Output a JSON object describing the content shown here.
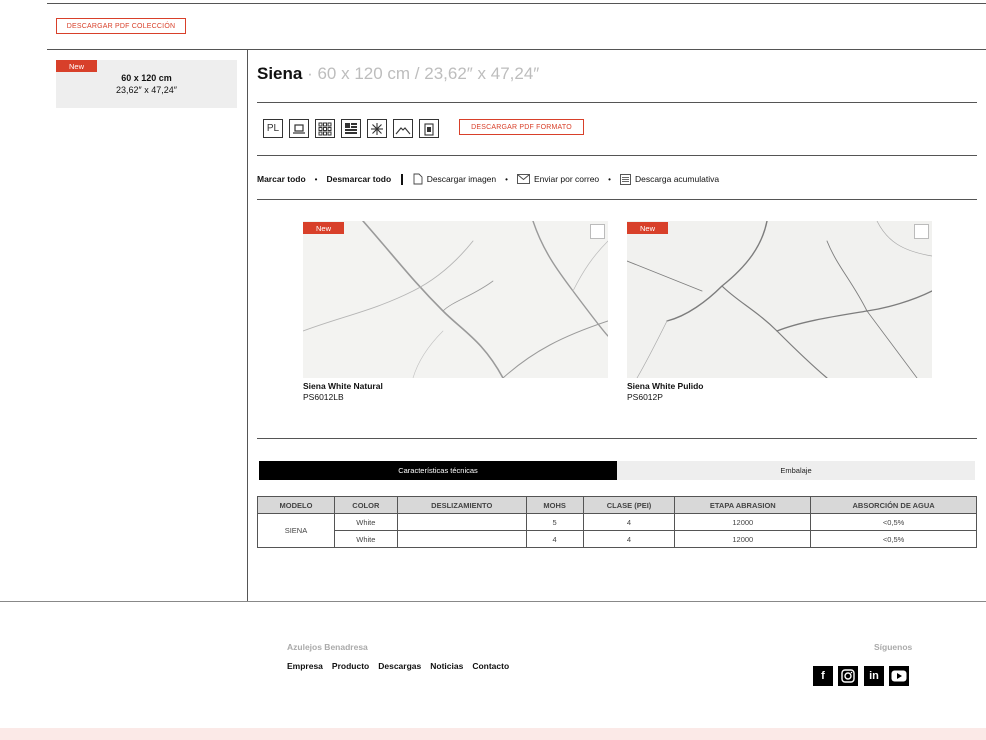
{
  "header": {
    "pdf_collection_label": "DESCARGAR PDF COLECCIÓN"
  },
  "format_card": {
    "badge": "New",
    "size_cm": "60 x 120 cm",
    "size_in": "23,62″ x 47,24″"
  },
  "title": {
    "name": "Siena",
    "size": "· 60 x 120 cm / 23,62″ x 47,24″"
  },
  "format_icons": [
    "pl-icon",
    "laptop-icon",
    "grid-pattern-icon",
    "layout-pattern-icon",
    "snowflake-icon",
    "envelope-icon",
    "bag-icon"
  ],
  "format_icon_text": {
    "pl": "PL"
  },
  "pdf_format_label": "DESCARGAR PDF FORMATO",
  "actions": {
    "mark_all": "Marcar todo",
    "unmark_all": "Desmarcar todo",
    "download_image": "Descargar imagen",
    "send_email": "Enviar por correo",
    "bulk_download": "Descarga acumulativa"
  },
  "products": [
    {
      "badge": "New",
      "name": "Siena White Natural",
      "code": "PS6012LB"
    },
    {
      "badge": "New",
      "name": "Siena White Pulido",
      "code": "PS6012P"
    }
  ],
  "tabs": {
    "tech": "Características técnicas",
    "packaging": "Embalaje"
  },
  "table": {
    "headers": [
      "MODELO",
      "COLOR",
      "DESLIZAMIENTO",
      "MOHS",
      "CLASE (PEI)",
      "ETAPA ABRASION",
      "ABSORCIÓN DE AGUA"
    ],
    "model": "SIENA",
    "rows": [
      {
        "color": "White",
        "slip": "",
        "mohs": "5",
        "pei": "4",
        "abrasion": "12000",
        "absorption": "<0,5%"
      },
      {
        "color": "White",
        "slip": "",
        "mohs": "4",
        "pei": "4",
        "abrasion": "12000",
        "absorption": "<0,5%"
      }
    ]
  },
  "footer": {
    "brand": "Azulejos Benadresa",
    "nav": [
      "Empresa",
      "Producto",
      "Descargas",
      "Noticias",
      "Contacto"
    ],
    "follow": "Síguenos",
    "social": [
      {
        "icon": "facebook-icon",
        "glyph": "f"
      },
      {
        "icon": "instagram-icon",
        "glyph": "◎"
      },
      {
        "icon": "linkedin-icon",
        "glyph": "in"
      },
      {
        "icon": "youtube-icon",
        "glyph": "▶"
      }
    ]
  },
  "colors": {
    "accent": "#d8402a",
    "tab_active": "#000000",
    "footer_bar": "#fbe9e7"
  }
}
